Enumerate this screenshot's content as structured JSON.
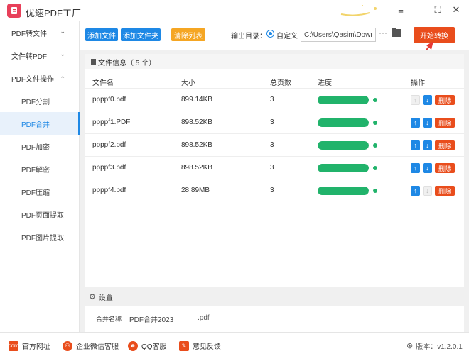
{
  "app": {
    "title": "优速PDF工厂"
  },
  "window_controls": {
    "menu": "≡",
    "minimize": "—",
    "maximize": "⛶",
    "close": "✕"
  },
  "sidebar": {
    "groups": [
      {
        "label": "PDF转文件",
        "chevron": "⌄"
      },
      {
        "label": "文件转PDF",
        "chevron": "⌄"
      },
      {
        "label": "PDF文件操作",
        "chevron": "⌃"
      }
    ],
    "sub_items": [
      {
        "label": "PDF分割",
        "active": false
      },
      {
        "label": "PDF合并",
        "active": true
      },
      {
        "label": "PDF加密",
        "active": false
      },
      {
        "label": "PDF解密",
        "active": false
      },
      {
        "label": "PDF压缩",
        "active": false
      },
      {
        "label": "PDF页面提取",
        "active": false
      },
      {
        "label": "PDF图片提取",
        "active": false
      }
    ]
  },
  "toolbar": {
    "add_file": "添加文件",
    "add_folder": "添加文件夹",
    "clear_list": "清除列表",
    "output_label": "输出目录：",
    "custom_label": "自定义",
    "output_path": "C:\\Users\\Qasim\\Downlo",
    "more": "···",
    "start": "开始转换"
  },
  "file_panel": {
    "header": "文件信息（ 5 个）",
    "columns": {
      "name": "文件名",
      "size": "大小",
      "pages": "总页数",
      "progress": "进度",
      "actions": "操作"
    },
    "delete_label": "删除",
    "files": [
      {
        "name": "ppppf0.pdf",
        "size": "899.14KB",
        "pages": "3",
        "progress": 1.0,
        "up_enabled": false,
        "down_enabled": true
      },
      {
        "name": "ppppf1.PDF",
        "size": "898.52KB",
        "pages": "3",
        "progress": 1.0,
        "up_enabled": true,
        "down_enabled": true
      },
      {
        "name": "ppppf2.pdf",
        "size": "898.52KB",
        "pages": "3",
        "progress": 1.0,
        "up_enabled": true,
        "down_enabled": true
      },
      {
        "name": "ppppf3.pdf",
        "size": "898.52KB",
        "pages": "3",
        "progress": 1.0,
        "up_enabled": true,
        "down_enabled": true
      },
      {
        "name": "ppppf4.pdf",
        "size": "28.89MB",
        "pages": "3",
        "progress": 1.0,
        "up_enabled": true,
        "down_enabled": false
      }
    ]
  },
  "settings": {
    "title": "设置",
    "merge_name_label": "合并名称:",
    "merge_name_value": "PDF合并2023",
    "merge_suffix": ".pdf"
  },
  "footer": {
    "website": "官方网址",
    "wechat": "企业微信客服",
    "qq": "QQ客服",
    "feedback": "意见反馈",
    "version": "版本：v1.2.0.1"
  },
  "colors": {
    "accent": "#1e88e5",
    "start": "#e94d1c",
    "clear": "#f5a623",
    "progress": "#21b36b"
  }
}
